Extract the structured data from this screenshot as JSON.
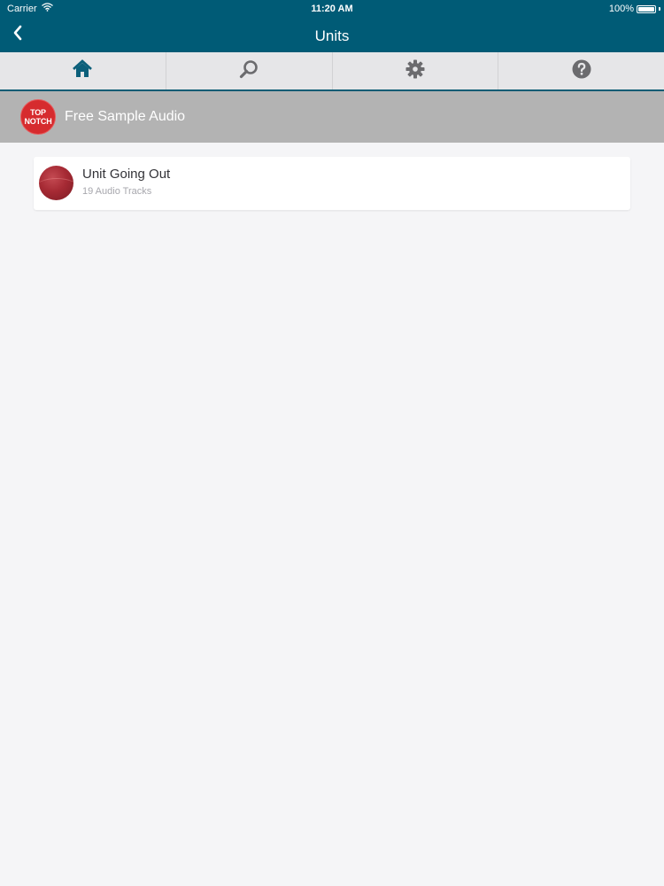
{
  "status_bar": {
    "carrier": "Carrier",
    "time": "11:20 AM",
    "battery": "100%"
  },
  "nav": {
    "title": "Units",
    "back_icon": "chevron-left-icon"
  },
  "tabs": [
    {
      "icon": "home-icon",
      "active": true
    },
    {
      "icon": "search-icon",
      "active": false
    },
    {
      "icon": "gear-icon",
      "active": false
    },
    {
      "icon": "help-icon",
      "active": false
    }
  ],
  "section": {
    "logo_text": "TOP NOTCH",
    "logo_line1": "TOP",
    "logo_line2": "NOTCH",
    "title": "Free Sample Audio"
  },
  "units": [
    {
      "title": "Unit Going Out",
      "subtitle": "19 Audio Tracks"
    }
  ],
  "colors": {
    "header": "#005b76",
    "active_tab_icon": "#0b5f7a",
    "inactive_tab_icon": "#6b6b6e",
    "section_bg": "#b3b3b3",
    "logo_red": "#d62b2e",
    "page_bg": "#f5f5f7"
  }
}
